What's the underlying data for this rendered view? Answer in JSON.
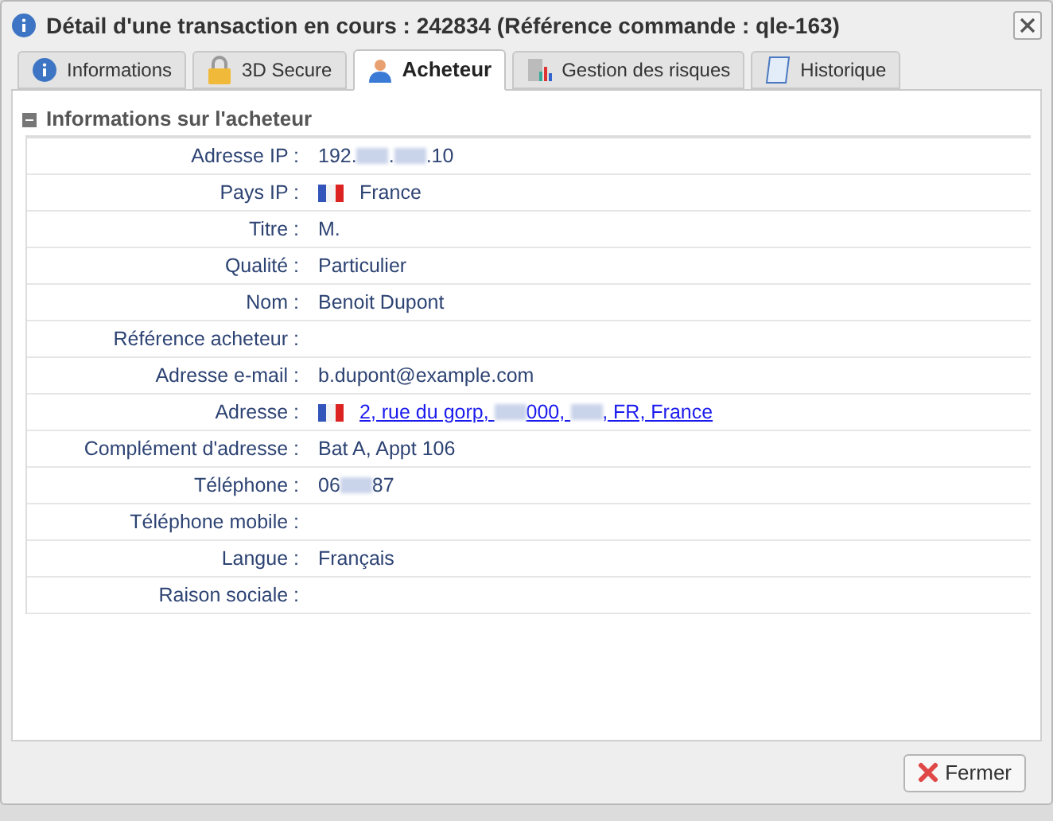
{
  "window": {
    "title": "Détail d'une transaction en cours : 242834 (Référence commande : qle-163)"
  },
  "tabs": [
    {
      "label": "Informations",
      "kind": "info",
      "selected": false
    },
    {
      "label": "3D Secure",
      "kind": "secure",
      "selected": false
    },
    {
      "label": "Acheteur",
      "kind": "buyer",
      "selected": true
    },
    {
      "label": "Gestion des risques",
      "kind": "risk",
      "selected": false
    },
    {
      "label": "Historique",
      "kind": "history",
      "selected": false
    }
  ],
  "section": {
    "title": "Informations sur l'acheteur",
    "expanded": true
  },
  "rows": [
    {
      "label": "Adresse IP :",
      "parts": [
        {
          "kind": "text",
          "text": "192."
        },
        {
          "kind": "redacted"
        },
        {
          "kind": "text",
          "text": "."
        },
        {
          "kind": "redacted"
        },
        {
          "kind": "text",
          "text": ".10"
        }
      ]
    },
    {
      "label": "Pays IP :",
      "flag": true,
      "parts": [
        {
          "kind": "text",
          "text": "France"
        }
      ]
    },
    {
      "label": "Titre :",
      "parts": [
        {
          "kind": "text",
          "text": "M."
        }
      ]
    },
    {
      "label": "Qualité :",
      "parts": [
        {
          "kind": "text",
          "text": "Particulier"
        }
      ]
    },
    {
      "label": "Nom :",
      "parts": [
        {
          "kind": "text",
          "text": "Benoit Dupont"
        }
      ]
    },
    {
      "label": "Référence acheteur :",
      "parts": []
    },
    {
      "label": "Adresse e-mail :",
      "parts": [
        {
          "kind": "text",
          "text": "b.dupont@example.com"
        }
      ]
    },
    {
      "label": "Adresse :",
      "flag": true,
      "link": true,
      "parts": [
        {
          "kind": "text",
          "text": "2, rue du gorp, "
        },
        {
          "kind": "redacted"
        },
        {
          "kind": "text",
          "text": "000, "
        },
        {
          "kind": "redacted"
        },
        {
          "kind": "text",
          "text": ", FR, France"
        }
      ]
    },
    {
      "label": "Complément d'adresse :",
      "parts": [
        {
          "kind": "text",
          "text": "Bat A, Appt 106"
        }
      ]
    },
    {
      "label": "Téléphone :",
      "parts": [
        {
          "kind": "text",
          "text": "06"
        },
        {
          "kind": "redacted"
        },
        {
          "kind": "text",
          "text": "87"
        }
      ]
    },
    {
      "label": "Téléphone mobile :",
      "parts": []
    },
    {
      "label": "Langue :",
      "parts": [
        {
          "kind": "text",
          "text": "Français"
        }
      ]
    },
    {
      "label": "Raison sociale :",
      "parts": []
    }
  ],
  "close_button": {
    "label": "Fermer"
  }
}
